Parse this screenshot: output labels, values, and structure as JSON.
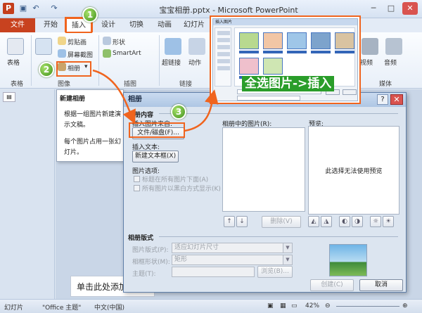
{
  "window": {
    "title": "宝宝相册.pptx - Microsoft PowerPoint",
    "minimize": "─",
    "maximize": "□",
    "close": "✕"
  },
  "ribbon": {
    "tabs": [
      "文件",
      "开始",
      "插入",
      "设计",
      "切换",
      "动画",
      "幻灯片"
    ],
    "active_tab": "插入",
    "items": {
      "table": "表格",
      "screenshot_pic": "剪贴画",
      "screen_capture": "屏幕截图",
      "album": "相册",
      "shapes": "形状",
      "smartart": "SmartArt",
      "hyperlink": "超链接",
      "action": "动作",
      "video": "视频",
      "audio": "音频"
    },
    "groups": {
      "table": "表格",
      "image": "图像",
      "illustrations": "插图",
      "links": "链接",
      "media": "媒体"
    }
  },
  "tooltip": {
    "title": "新建相册",
    "body1": "根据一组图片新建演示文稿。",
    "body2": "每个图片占用一张幻灯片。"
  },
  "notes": {
    "text": "单击此处添加"
  },
  "statusbar": {
    "slide": "幻灯片",
    "theme": "\"Office 主题\"",
    "language": "中文(中国)",
    "zoom": "42%"
  },
  "dialog": {
    "title": "相册",
    "help": "?",
    "close": "✕",
    "content_label": "相册内容",
    "insert_picture_from": "插入图片来自:",
    "file_disk_button": "文件/磁盘(F)...",
    "insert_text": "插入文本:",
    "new_textbox_button": "新建文本框(X)",
    "picture_options": "图片选项:",
    "option_caption": "标题在所有图片下面(A)",
    "option_bw": "所有图片以黑白方式显示(K)",
    "pictures_in_album": "相册中的图片(R):",
    "preview_label": "预览:",
    "preview_message": "此选择无法使用预览",
    "remove_button": "删除(V)",
    "layout_section": "相册版式",
    "picture_layout_label": "图片版式(P):",
    "picture_layout_value": "适应幻灯片尺寸",
    "frame_shape_label": "相框形状(M):",
    "frame_shape_value": "矩形",
    "theme_label": "主题(T):",
    "browse_button": "浏览(B)...",
    "create_button": "创建(C)",
    "cancel_button": "取消"
  },
  "overlay": {
    "instruction": "全选图片->插入",
    "mini_title": "插入图片",
    "badges": [
      "1",
      "2",
      "3"
    ]
  },
  "colors": {
    "highlight": "#f0641e",
    "badge_green": "#3f8f1a",
    "file_tab": "#c8421f"
  }
}
